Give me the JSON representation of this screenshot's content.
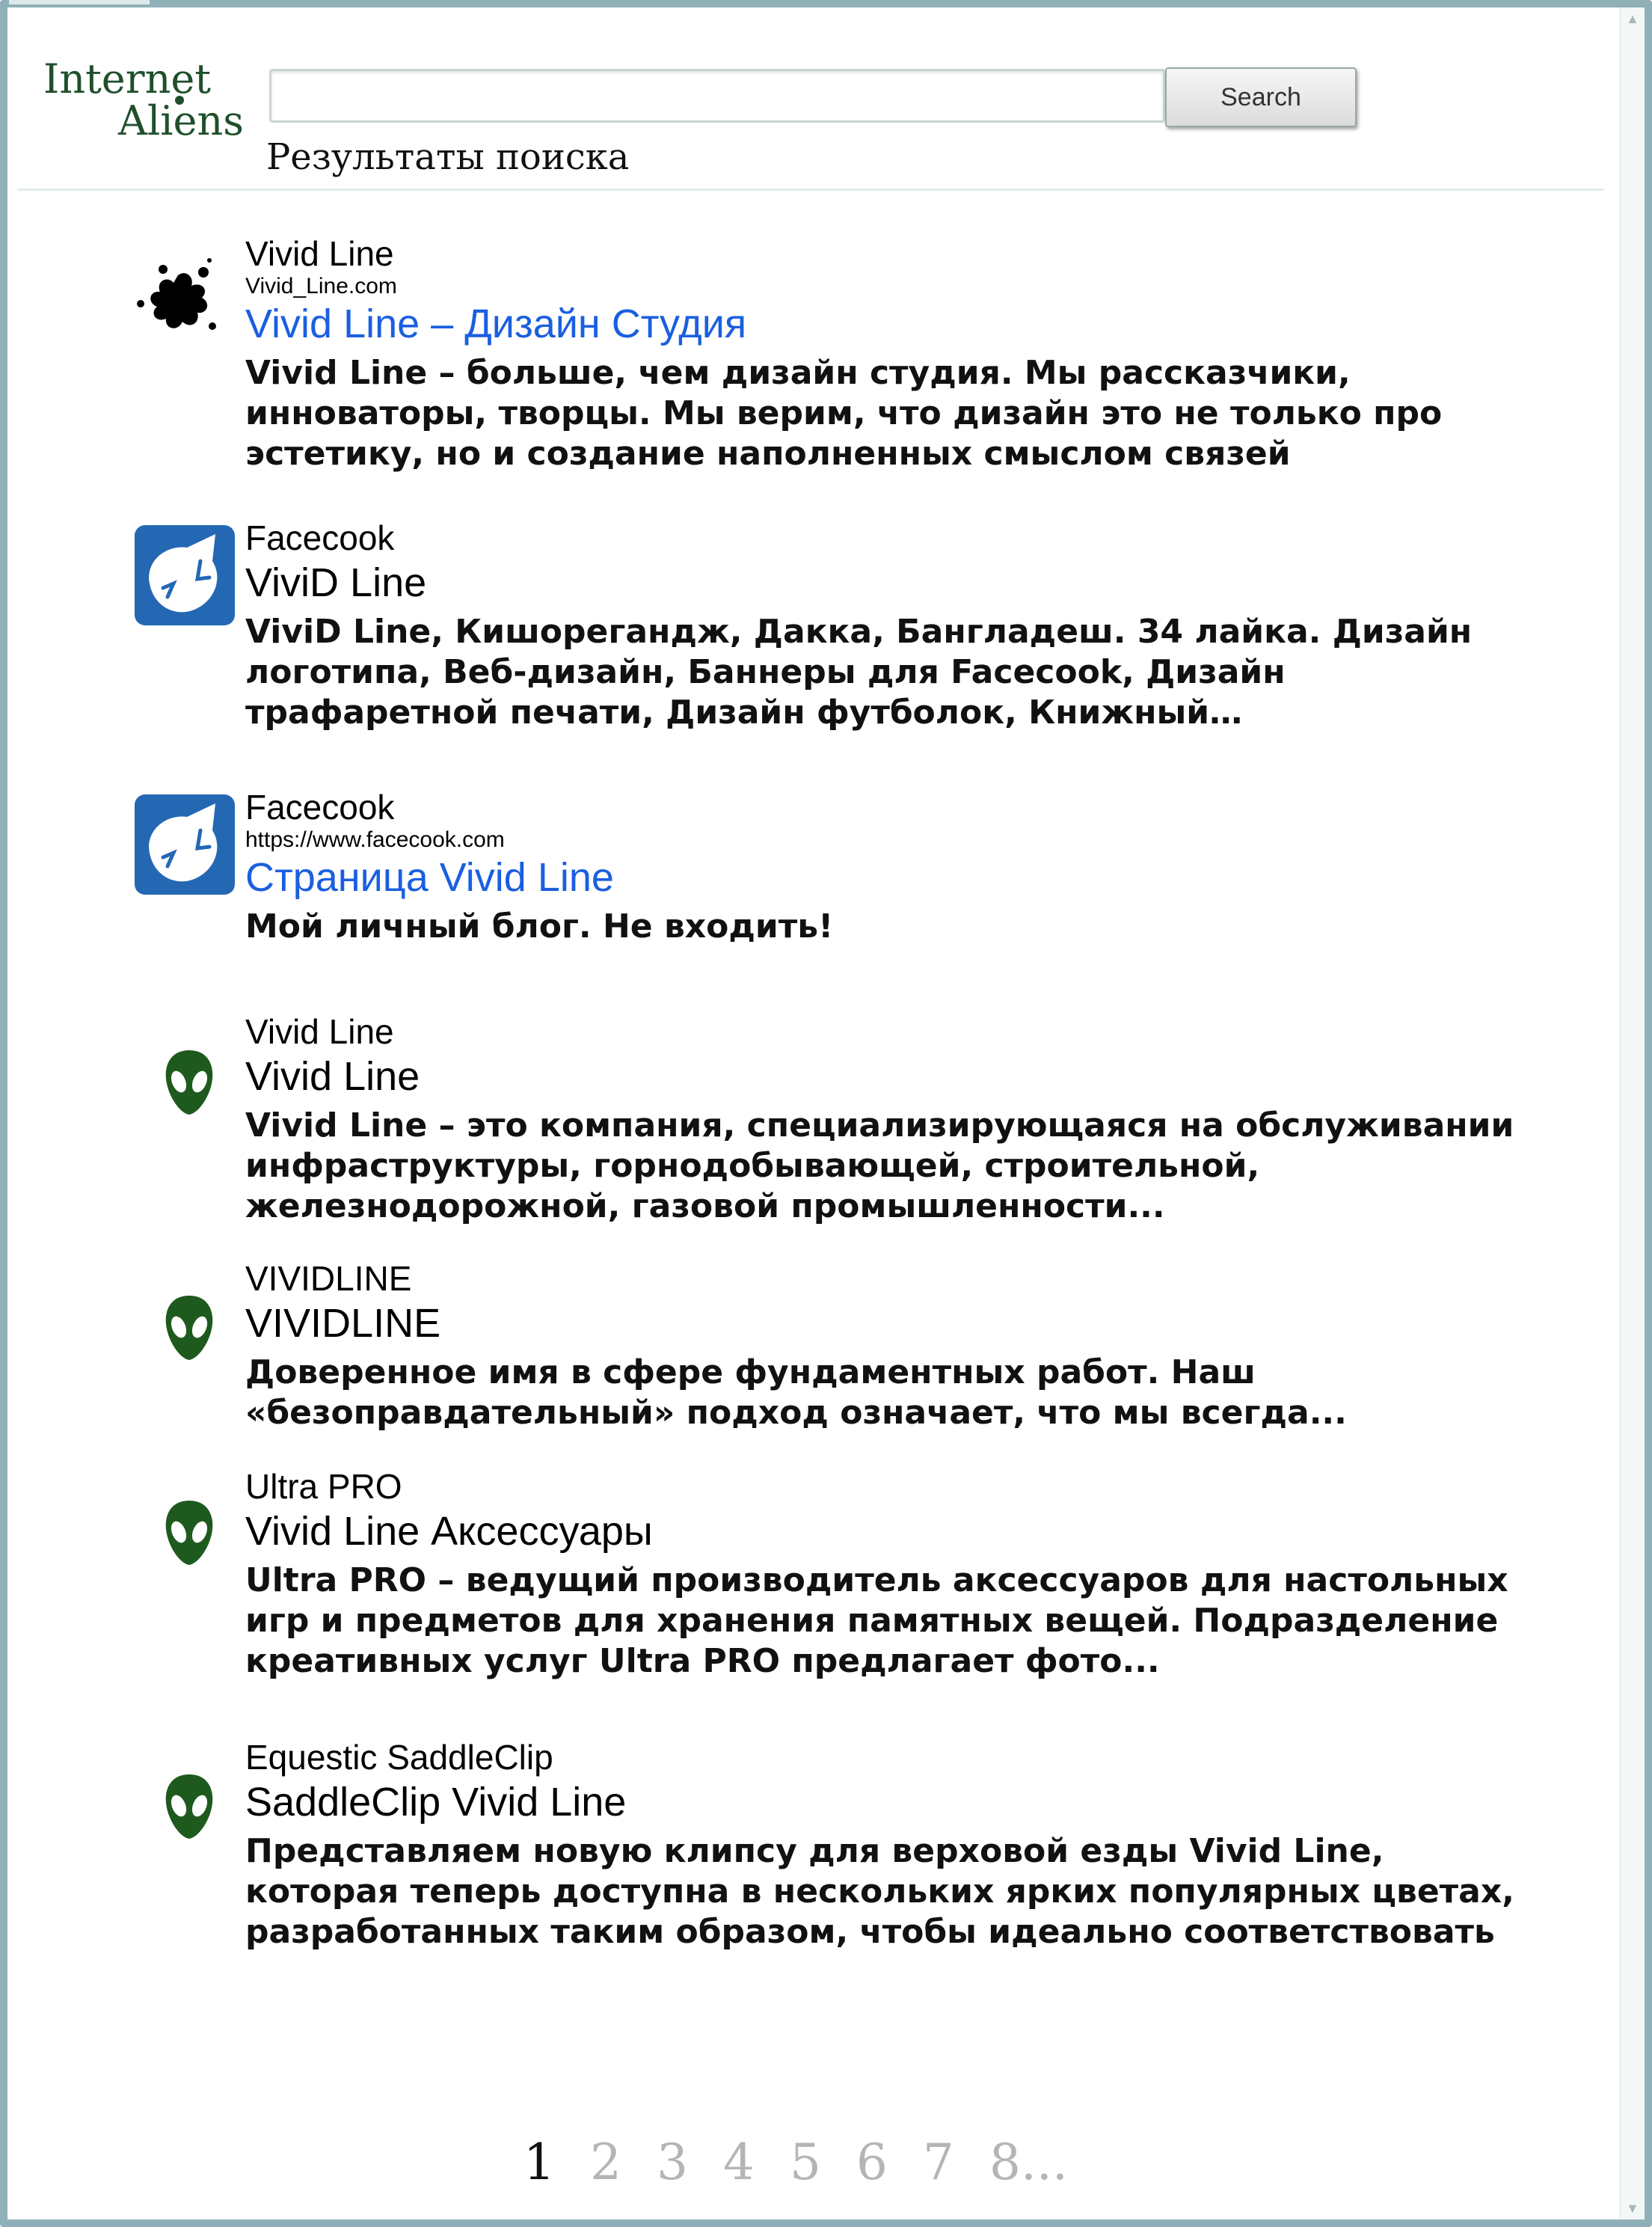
{
  "header": {
    "logo_line1": "Internet",
    "logo_line2": "Aliens",
    "search_value": "",
    "search_button": "Search",
    "results_heading": "Результаты поиска"
  },
  "results": [
    {
      "icon": "splat-icon",
      "source": "Vivid Line",
      "url": "Vivid_Line.com",
      "title": "Vivid Line – Дизайн Студия",
      "title_is_link": true,
      "snippet": "Vivid Line – больше, чем дизайн студия. Мы рассказчики, инноваторы, творцы. Мы верим, что дизайн это не только про эстетику, но и создание наполненных смыслом связей"
    },
    {
      "icon": "facecook-icon",
      "source": "Facecook",
      "url": "",
      "title": "ViviD Line",
      "title_is_link": false,
      "snippet": "ViviD Line, Кишорегандж, Дакка, Бангладеш. 34  лайка. Дизайн логотипа, Веб-дизайн, Баннеры для Facecook, Дизайн трафаретной печати, Дизайн футболок, Книжный…"
    },
    {
      "icon": "facecook-icon",
      "source": "Facecook",
      "url": "https://www.facecook.com",
      "title": "Страница Vivid Line",
      "title_is_link": true,
      "snippet": "Мой личный блог. Не входить!"
    },
    {
      "icon": "alien-icon",
      "source": "Vivid Line",
      "url": "",
      "title": "Vivid Line",
      "title_is_link": false,
      "snippet": "Vivid Line – это компания, специализирующаяся на обслуживании инфраструктуры, горнодобывающей, строительной, железнодорожной, газовой промышленности..."
    },
    {
      "icon": "alien-icon",
      "source": "VIVIDLINE",
      "url": "",
      "title": "VIVIDLINE",
      "title_is_link": false,
      "snippet": "Доверенное имя в сфере фундаментных работ. Наш «безоправдательный» подход означает, что мы всегда..."
    },
    {
      "icon": "alien-icon",
      "source": "Ultra PRO",
      "url": "",
      "title": "Vivid Line Аксессуары",
      "title_is_link": false,
      "snippet": "Ultra PRO – ведущий производитель аксессуаров для настольных игр и предметов для хранения памятных вещей. Подразделение креативных услуг Ultra PRO предлагает фото..."
    },
    {
      "icon": "alien-icon",
      "source": "Equestic SaddleClip",
      "url": "",
      "title": "SaddleClip Vivid Line",
      "title_is_link": false,
      "snippet": "Представляем новую клипсу для верховой езды Vivid Line, которая теперь доступна в нескольких ярких популярных цветах, разработанных таким образом, чтобы идеально соответствовать"
    }
  ],
  "pagination": {
    "pages": [
      "1",
      "2",
      "3",
      "4",
      "5",
      "6",
      "7",
      "8..."
    ],
    "current": "1"
  },
  "colors": {
    "link": "#1a5fe0",
    "logo": "#1f4f2b",
    "alien": "#1e5a1e",
    "facecook": "#2468b4",
    "frame": "#8fb0b6"
  }
}
